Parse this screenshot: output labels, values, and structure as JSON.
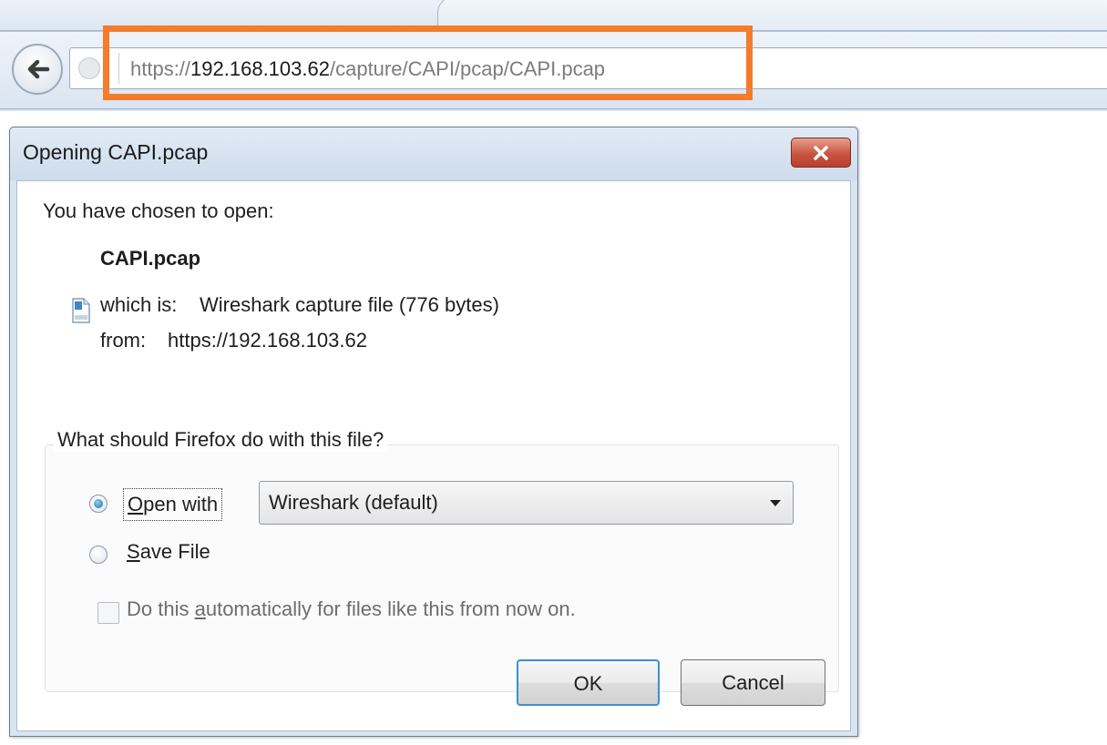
{
  "browser": {
    "url_prefix": "https://",
    "url_host": "192.168.103.62",
    "url_path": "/capture/CAPI/pcap/CAPI.pcap"
  },
  "highlight_color": "#f47c2a",
  "dialog": {
    "title": "Opening CAPI.pcap",
    "intro": "You have chosen to open:",
    "file_name": "CAPI.pcap",
    "which_is_label": "which is:",
    "which_is_value": "Wireshark capture file (776 bytes)",
    "from_label": "from:",
    "from_value": "https://192.168.103.62",
    "group_label": "What should Firefox do with this file?",
    "open_with": {
      "mnemonic": "O",
      "rest": "pen with",
      "selected": true
    },
    "open_with_app": "Wireshark (default)",
    "save_file": {
      "mnemonic": "S",
      "rest": "ave File",
      "selected": false
    },
    "auto_checkbox": {
      "before": "Do this ",
      "mnemonic": "a",
      "after": "utomatically for files like this from now on.",
      "checked": false,
      "enabled": false
    },
    "ok_label": "OK",
    "cancel_label": "Cancel"
  }
}
